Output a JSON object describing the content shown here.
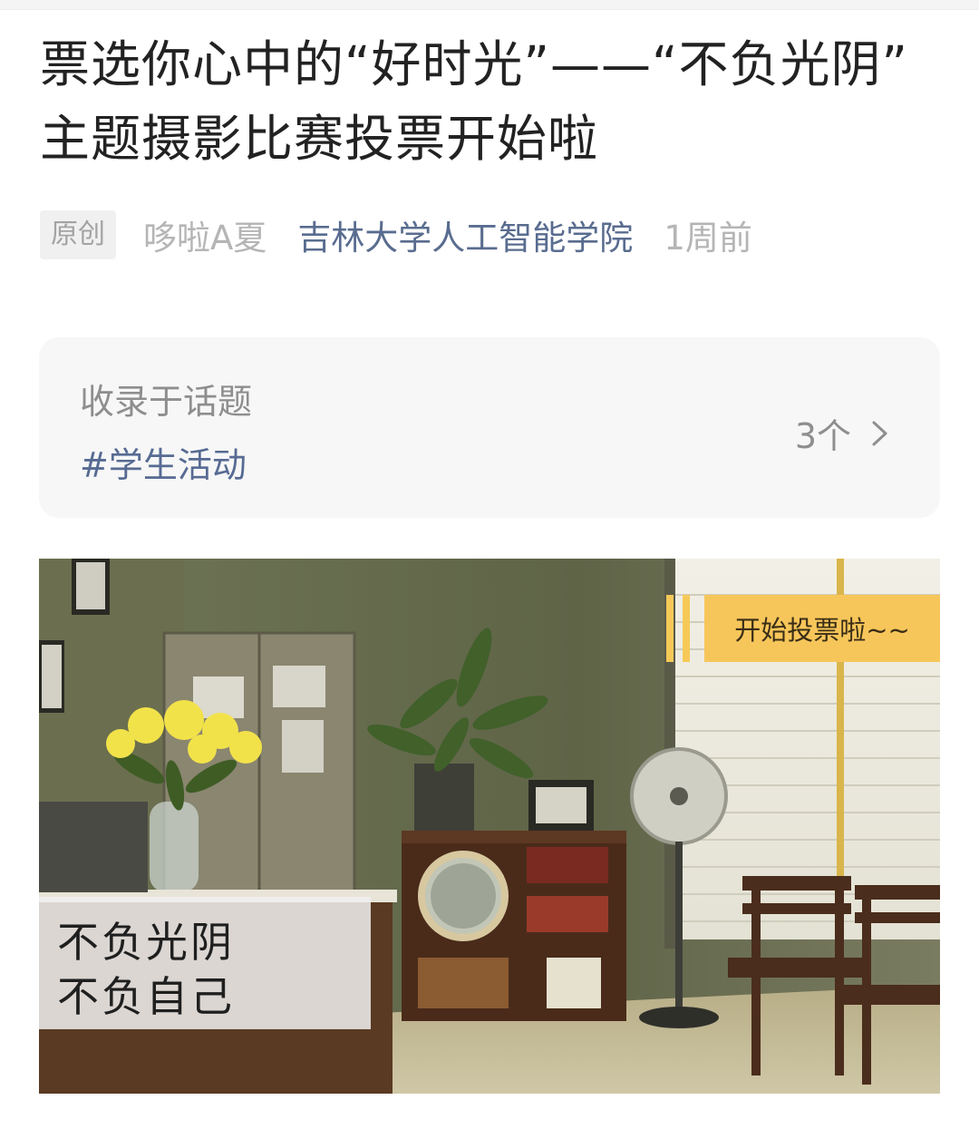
{
  "article": {
    "title_line1": "票选你心中的“好时光”——“不负光阴”",
    "title_line2": "主题摄影比赛投票开始啦",
    "original_badge": "原创",
    "author": "哆啦A夏",
    "account": "吉林大学人工智能学院",
    "time": "1周前"
  },
  "topic": {
    "heading": "收录于话题",
    "tag": "#学生活动",
    "count": "3个",
    "chevron_icon": "chevron-right-icon"
  },
  "cover": {
    "banner_text": "开始投票啦~~",
    "overlay_line1": "不负光阴",
    "overlay_line2": "不负自己",
    "banner_color": "#f7c65a"
  }
}
